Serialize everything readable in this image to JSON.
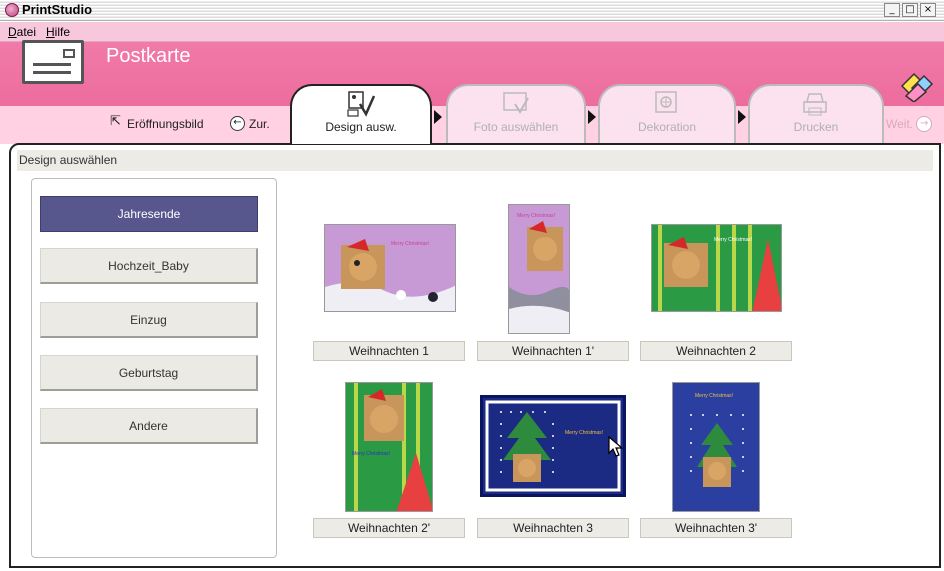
{
  "window": {
    "title": "PrintStudio",
    "controls": [
      "_",
      "□",
      "×"
    ]
  },
  "menu": {
    "items": [
      {
        "label": "Datei",
        "mnemonic": "D",
        "rest": "atei"
      },
      {
        "label": "Hilfe",
        "mnemonic": "H",
        "rest": "ilfe"
      }
    ]
  },
  "header": {
    "title": "Postkarte",
    "links": [
      {
        "label": "Eröffnungsbild",
        "icon": "home-up-icon"
      },
      {
        "label": "Zur.",
        "icon": "back-arrow-icon"
      }
    ],
    "next_label": "Weit.",
    "tabs": [
      {
        "label": "Design ausw.",
        "icon": "design-icon",
        "active": true
      },
      {
        "label": "Foto auswählen",
        "icon": "photo-icon",
        "active": false
      },
      {
        "label": "Dekoration",
        "icon": "decoration-icon",
        "active": false
      },
      {
        "label": "Drucken",
        "icon": "printer-icon",
        "active": false
      }
    ]
  },
  "section": {
    "title": "Design auswählen"
  },
  "categories": [
    {
      "label": "Jahresende",
      "selected": true
    },
    {
      "label": "Hochzeit_Baby",
      "selected": false
    },
    {
      "label": "Einzug",
      "selected": false
    },
    {
      "label": "Geburtstag",
      "selected": false
    },
    {
      "label": "Andere",
      "selected": false
    }
  ],
  "designs": [
    {
      "caption": "Weihnachten 1",
      "theme": "pink-landscape"
    },
    {
      "caption": "Weihnachten 1'",
      "theme": "pink-portrait"
    },
    {
      "caption": "Weihnachten 2",
      "theme": "green-landscape"
    },
    {
      "caption": "Weihnachten 2'",
      "theme": "green-portrait"
    },
    {
      "caption": "Weihnachten 3",
      "theme": "blue-landscape",
      "selected": true
    },
    {
      "caption": "Weihnachten 3'",
      "theme": "blue-portrait"
    }
  ],
  "colors": {
    "header_pink": "#ea6497",
    "menu_pink": "#f7c7dc",
    "selected_category": "#57578e",
    "green_card": "#2a9a45",
    "blue_card": "#1b2a82",
    "pink_card": "#c79ad6"
  }
}
